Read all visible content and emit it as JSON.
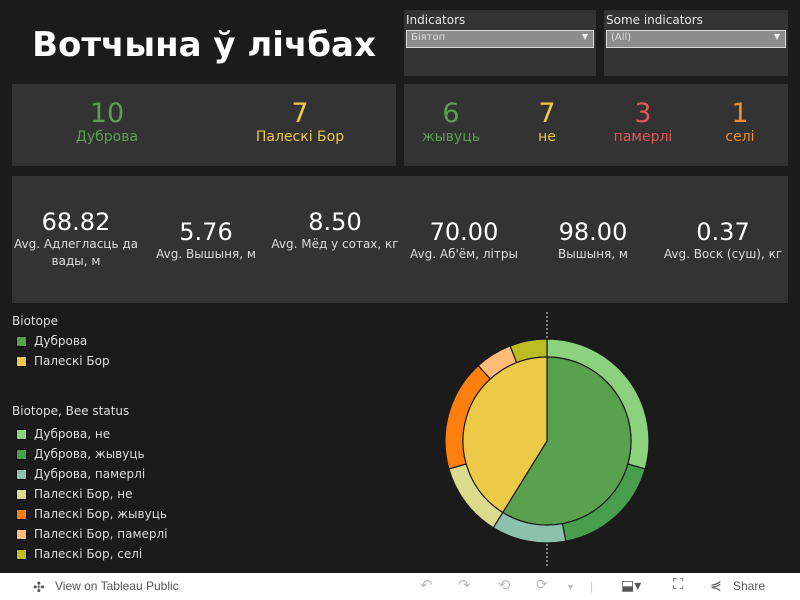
{
  "title": "Вотчына ў лічбах",
  "filters": [
    {
      "label": "Indicators",
      "value": "Біятоп"
    },
    {
      "label": "Some indicators",
      "value": "(All)"
    }
  ],
  "biotope_kpis": [
    {
      "value": "10",
      "label": "Дуброва",
      "color": "#59a14f"
    },
    {
      "value": "7",
      "label": "Палескі Бор",
      "color": "#edc948"
    }
  ],
  "status_kpis": [
    {
      "value": "6",
      "label": "жывуць",
      "color": "#59a14f"
    },
    {
      "value": "7",
      "label": "не",
      "color": "#edc948"
    },
    {
      "value": "3",
      "label": "памерлі",
      "color": "#e15759"
    },
    {
      "value": "1",
      "label": "селі",
      "color": "#f28e2b"
    }
  ],
  "metrics": [
    {
      "value": "68.82",
      "label": "Avg. Адлегласць да вады, м"
    },
    {
      "value": "5.76",
      "label": "Avg. Вышыня, м"
    },
    {
      "value": "8.50",
      "label": "Avg. Мёд у сотах, кг"
    },
    {
      "value": "70.00",
      "label": "Avg. Аб'ём, літры"
    },
    {
      "value": "98.00",
      "label": "Вышыня, м"
    },
    {
      "value": "0.37",
      "label": "Avg. Воск (суш), кг"
    }
  ],
  "legend1": {
    "title": "Biotope",
    "items": [
      {
        "label": "Дуброва",
        "color": "#59a14f"
      },
      {
        "label": "Палескі Бор",
        "color": "#edc948"
      }
    ]
  },
  "legend2": {
    "title": "Biotope, Bee status",
    "items": [
      {
        "label": "Дуброва, не",
        "color": "#8cd17d"
      },
      {
        "label": "Дуброва, жывуць",
        "color": "#499e4d"
      },
      {
        "label": "Дуброва, памерлі",
        "color": "#8cc1ad"
      },
      {
        "label": "Палескі Бор, не",
        "color": "#dbdb8d"
      },
      {
        "label": "Палескі Бор, жывуць",
        "color": "#ff7f0e"
      },
      {
        "label": "Палескі Бор, памерлі",
        "color": "#ffbb78"
      },
      {
        "label": "Палескі Бор, селі",
        "color": "#bcbd22"
      }
    ]
  },
  "chart_data": {
    "type": "pie",
    "inner": {
      "categories": [
        "Дуброва",
        "Палескі Бор"
      ],
      "values": [
        10,
        7
      ]
    },
    "outer": {
      "categories": [
        "Дуброва, не",
        "Дуброва, жывуць",
        "Дуброва, памерлі",
        "Палескі Бор, не",
        "Палескі Бор, жывуць",
        "Палескі Бор, памерлі",
        "Палескі Бор, селі"
      ],
      "values": [
        5,
        3,
        2,
        2,
        3,
        1,
        1
      ]
    }
  },
  "footer": {
    "view": "View on Tableau Public",
    "share": "Share"
  }
}
